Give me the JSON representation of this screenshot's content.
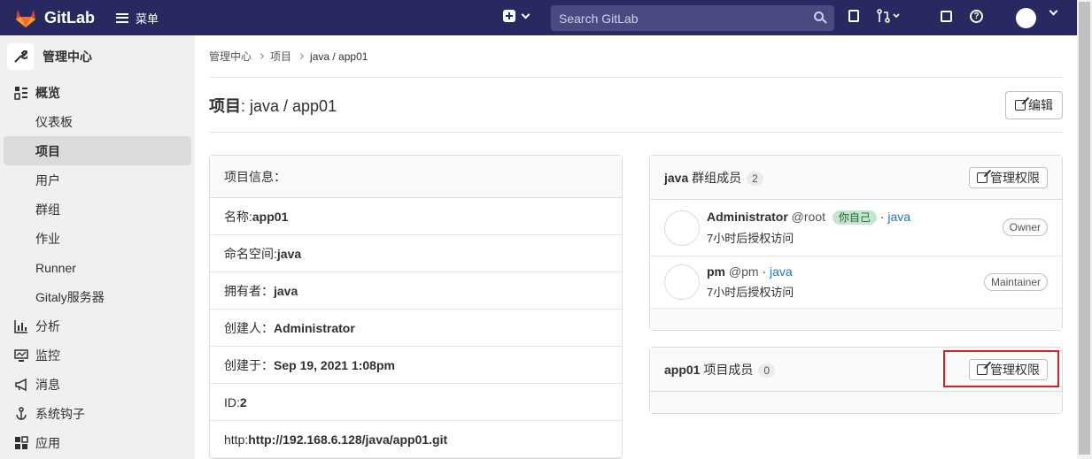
{
  "navbar": {
    "brand": "GitLab",
    "menu_label": "菜单",
    "search_placeholder": "Search GitLab"
  },
  "sidebar": {
    "header": "管理中心",
    "items": [
      {
        "label": "概览",
        "icon": "overview-icon"
      },
      {
        "label": "仪表板"
      },
      {
        "label": "项目"
      },
      {
        "label": "用户"
      },
      {
        "label": "群组"
      },
      {
        "label": "作业"
      },
      {
        "label": "Runner"
      },
      {
        "label": "Gitaly服务器"
      },
      {
        "label": "分析",
        "icon": "chart-icon"
      },
      {
        "label": "监控",
        "icon": "monitor-icon"
      },
      {
        "label": "消息",
        "icon": "bullhorn-icon"
      },
      {
        "label": "系统钩子",
        "icon": "hook-icon"
      },
      {
        "label": "应用",
        "icon": "apps-icon"
      }
    ]
  },
  "breadcrumb": [
    "管理中心",
    "项目",
    "java / app01"
  ],
  "page": {
    "title_bold": "项目",
    "title_rest": ": java / app01",
    "edit_label": "编辑"
  },
  "project_info": {
    "header": "项目信息：",
    "rows": [
      {
        "label": "名称: ",
        "value": "app01"
      },
      {
        "label": "命名空间: ",
        "value": "java"
      },
      {
        "label": "拥有者：",
        "value": "java"
      },
      {
        "label": "创建人：",
        "value": "Administrator"
      },
      {
        "label": "创建于：",
        "value": "Sep 19, 2021 1:08pm"
      },
      {
        "label": "ID: ",
        "value": "2"
      },
      {
        "label": "http: ",
        "value": "http://192.168.6.128/java/app01.git"
      }
    ]
  },
  "group_members": {
    "name": "java",
    "title": " 群组成员",
    "count": "2",
    "manage_label": "管理权限",
    "members": [
      {
        "name": "Administrator",
        "username": " @root",
        "you": "你自己",
        "sep": " · ",
        "group": "java",
        "access": "7小时后授权访问",
        "role": "Owner"
      },
      {
        "name": "pm",
        "username": " @pm",
        "sep": " · ",
        "group": "java",
        "access": "7小时后授权访问",
        "role": "Maintainer"
      }
    ]
  },
  "project_members": {
    "name": "app01",
    "title": " 项目成员",
    "count": "0",
    "manage_label": "管理权限"
  },
  "colors": {
    "navbar": "#292961",
    "highlight": "#d81f26",
    "link": "#1f75cb"
  }
}
